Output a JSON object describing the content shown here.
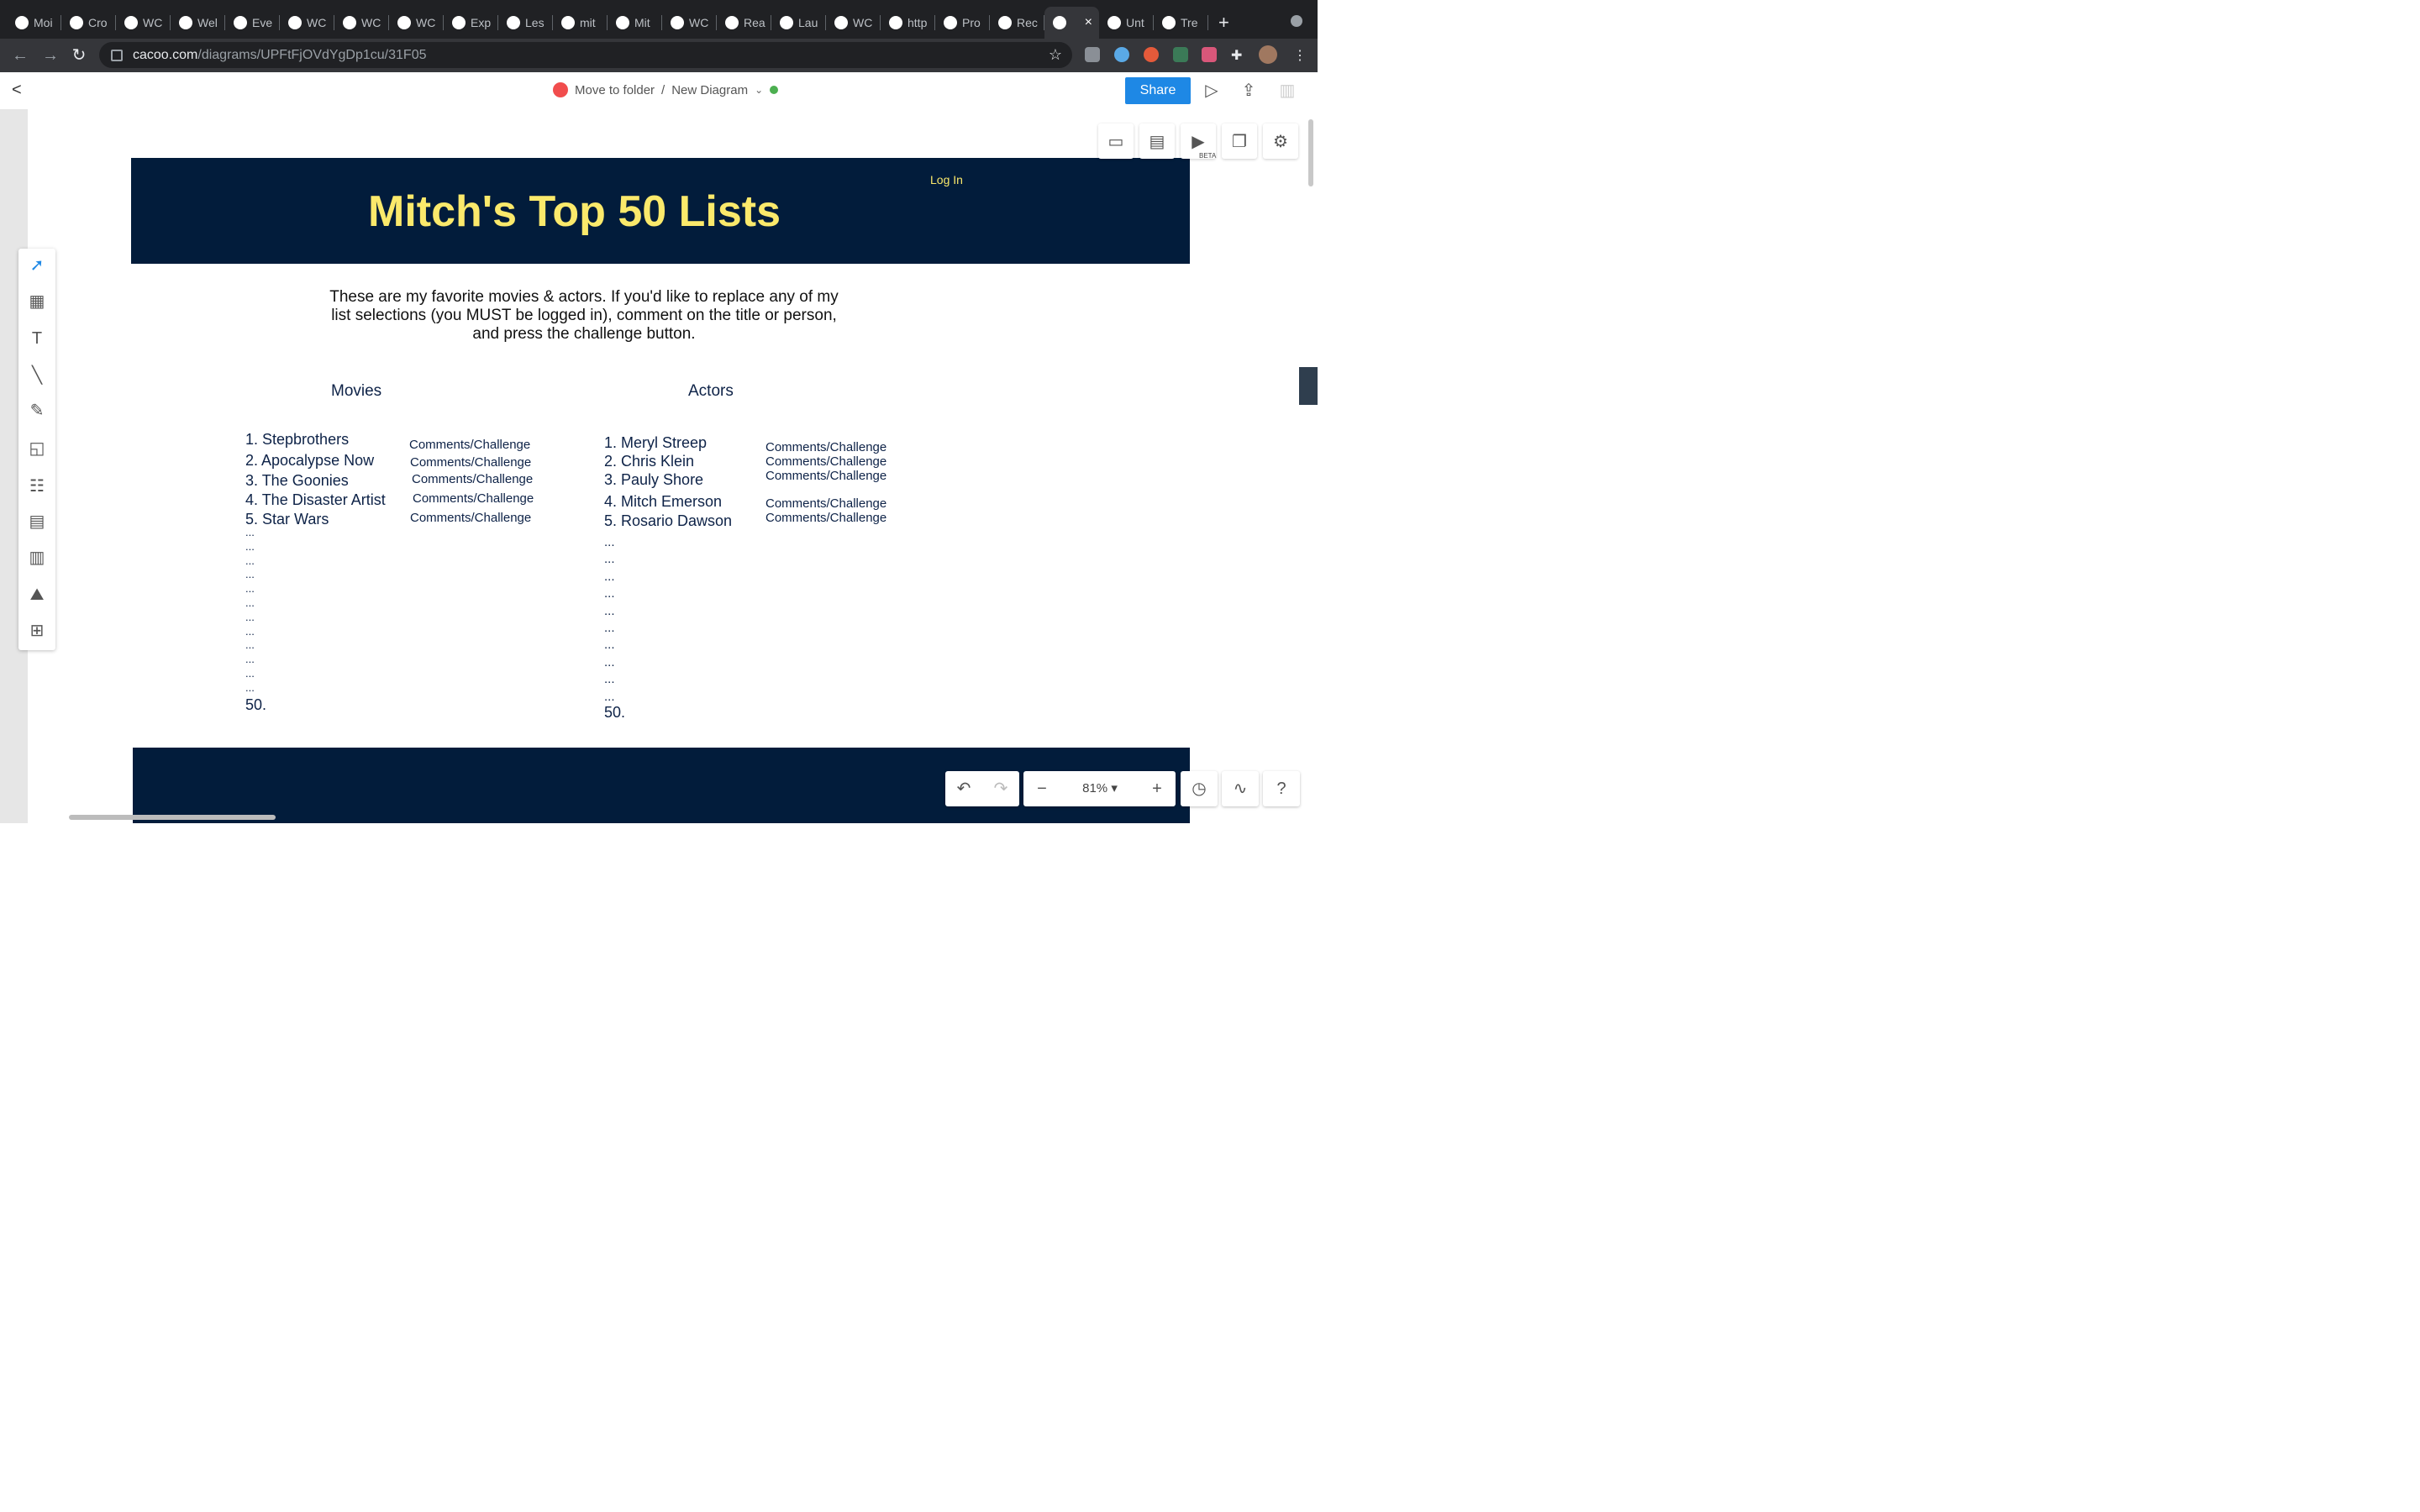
{
  "browser": {
    "tabs": [
      {
        "label": "Moi",
        "icon": "globe-icon"
      },
      {
        "label": "Cro",
        "icon": "paw-icon"
      },
      {
        "label": "WC",
        "icon": "github-icon"
      },
      {
        "label": "Wel",
        "icon": "paw-icon"
      },
      {
        "label": "Eve",
        "icon": "paw-icon"
      },
      {
        "label": "WC",
        "icon": "github-icon"
      },
      {
        "label": "WC",
        "icon": "github-icon"
      },
      {
        "label": "WC",
        "icon": "github-icon"
      },
      {
        "label": "Exp",
        "icon": "paw-icon"
      },
      {
        "label": "Les",
        "icon": "lesson-icon"
      },
      {
        "label": "mit",
        "icon": "github-icon"
      },
      {
        "label": "Mit",
        "icon": "sheets-icon"
      },
      {
        "label": "WC",
        "icon": "github-icon"
      },
      {
        "label": "Rea",
        "icon": "react-icon"
      },
      {
        "label": "Lau",
        "icon": "zoom-icon"
      },
      {
        "label": "WC",
        "icon": "github-icon"
      },
      {
        "label": "http",
        "icon": "globe-icon"
      },
      {
        "label": "Pro",
        "icon": "hi-icon"
      },
      {
        "label": "Rec",
        "icon": "cacoo-icon"
      },
      {
        "label": "",
        "icon": "cacoo-icon",
        "active": true
      },
      {
        "label": "Unt",
        "icon": "cacoo-icon"
      },
      {
        "label": "Tre",
        "icon": "chrome-icon"
      }
    ],
    "url_domain": "cacoo.com",
    "url_path": "/diagrams/UPFtFjOVdYgDp1cu/31F05"
  },
  "app": {
    "breadcrumb_folder": "Move to folder",
    "breadcrumb_sep": "/",
    "diagram_name": "New Diagram",
    "share_label": "Share",
    "beta_label": "BETA",
    "zoom_level": "81%"
  },
  "diagram": {
    "title": "Mitch's Top 50 Lists",
    "login": "Log In",
    "intro": "These are my favorite movies & actors.  If you'd like to replace any of my list selections (you MUST be logged in), comment on the title or person, and press the challenge button.",
    "movies_heading": "Movies",
    "actors_heading": "Actors",
    "movies": [
      "1. Stepbrothers",
      "2. Apocalypse Now",
      "3. The Goonies",
      "4. The Disaster Artist",
      "5. Star Wars"
    ],
    "actors": [
      "1. Meryl Streep",
      "2. Chris Klein",
      "3. Pauly Shore",
      "4. Mitch Emerson",
      "5. Rosario Dawson"
    ],
    "challenge_label": "Comments/Challenge",
    "ellipsis": "...",
    "last_item": "50."
  }
}
